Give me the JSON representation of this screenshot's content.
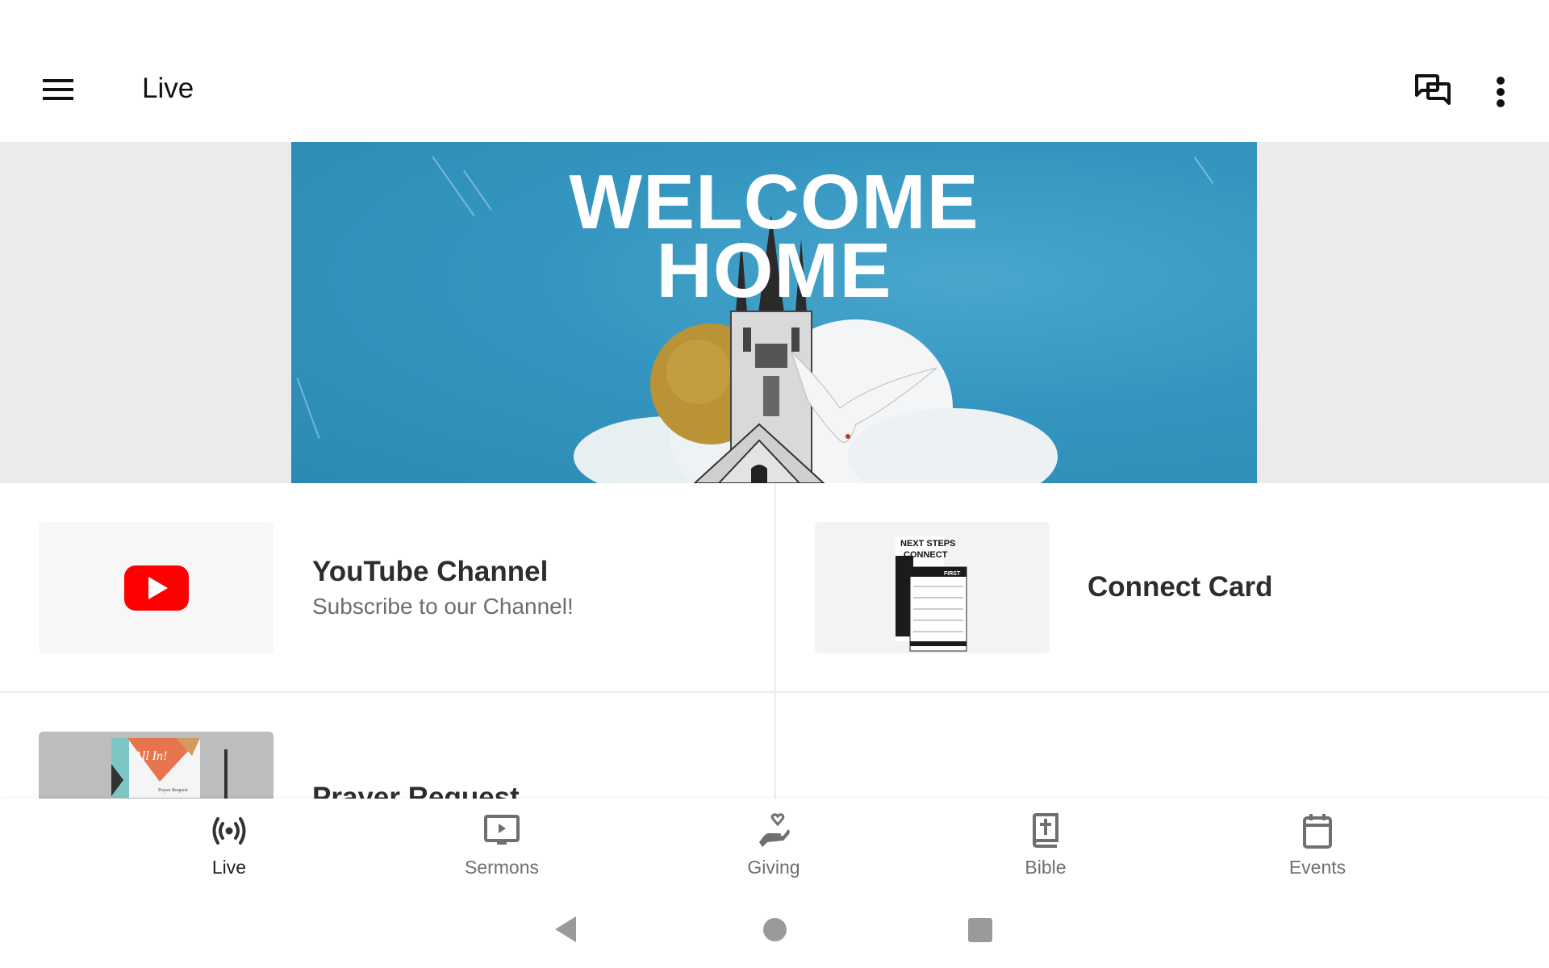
{
  "header": {
    "title": "Live",
    "menu_icon": "hamburger-menu-icon",
    "chat_icon": "forum-chat-icon",
    "more_icon": "more-vert-icon"
  },
  "banner": {
    "line1": "WELCOME",
    "line2": "HOME",
    "background_color": "#3496c0"
  },
  "tiles": [
    {
      "title": "YouTube Channel",
      "subtitle": "Subscribe to our Channel!",
      "thumb": "youtube-logo",
      "thumb_color": "#ff0000"
    },
    {
      "title": "Connect Card",
      "subtitle": "",
      "thumb": "connect-card-image",
      "thumb_text": [
        "NEXT STEPS",
        "CONNECT",
        "FIRST"
      ]
    },
    {
      "title": "Prayer Request",
      "subtitle": "",
      "thumb": "prayer-request-card-image",
      "thumb_text": [
        "All In!",
        "Prayer Request"
      ]
    }
  ],
  "bottom_nav": {
    "items": [
      {
        "label": "Live",
        "icon": "live-broadcast-icon",
        "active": true
      },
      {
        "label": "Sermons",
        "icon": "video-play-icon",
        "active": false
      },
      {
        "label": "Giving",
        "icon": "giving-hand-heart-icon",
        "active": false
      },
      {
        "label": "Bible",
        "icon": "bible-book-icon",
        "active": false
      },
      {
        "label": "Events",
        "icon": "calendar-icon",
        "active": false
      }
    ]
  },
  "system_nav": {
    "back": "back-triangle-icon",
    "home": "home-circle-icon",
    "recents": "recents-square-icon"
  }
}
